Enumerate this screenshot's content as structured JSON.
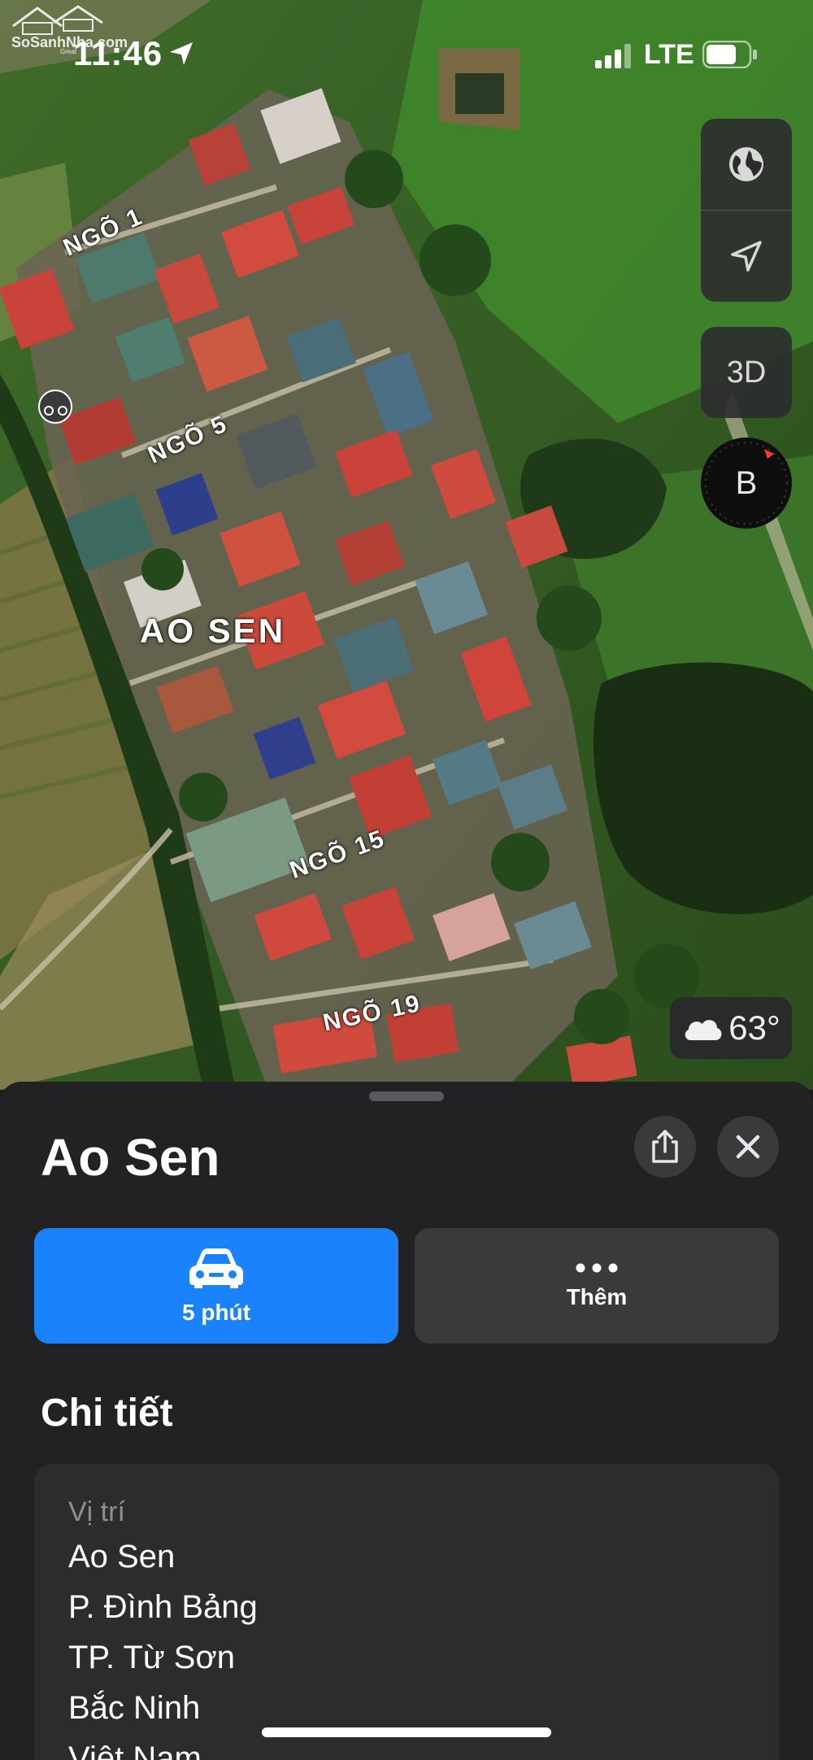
{
  "status_bar": {
    "time": "11:46",
    "network": "LTE"
  },
  "watermark": {
    "text": "SoSanhNha.com",
    "tagline": "Great"
  },
  "map": {
    "area_label": "AO SEN",
    "roads": [
      "NGÕ 1",
      "NGÕ 5",
      "NGÕ 15",
      "NGÕ 19"
    ],
    "controls": {
      "three_d_label": "3D",
      "compass_label": "B"
    },
    "weather": {
      "temperature": "63°",
      "icon": "cloud-icon"
    }
  },
  "place": {
    "title": "Ao Sen",
    "actions": {
      "directions": {
        "label": "5 phút",
        "icon": "car-icon",
        "color": "#1a82fb"
      },
      "more": {
        "label": "Thêm",
        "icon": "ellipsis-icon"
      }
    }
  },
  "details": {
    "heading": "Chi tiết",
    "location_caption": "Vị trí",
    "address_lines": [
      "Ao Sen",
      "P. Đình Bảng",
      "TP. Từ Sơn",
      "Bắc Ninh",
      "Việt Nam"
    ]
  },
  "colors": {
    "accent": "#1a82fb",
    "sheet_bg": "#222224",
    "card_bg": "#2c2c2e",
    "compass_marker": "#ff3b30"
  }
}
